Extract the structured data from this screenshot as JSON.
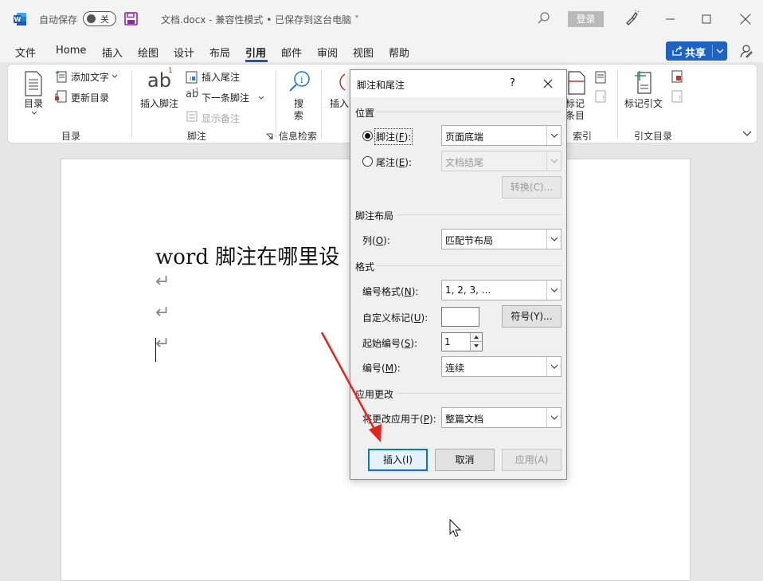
{
  "titlebar": {
    "autosave_label": "自动保存",
    "autosave_state": "关",
    "doc_title": "文档.docx  -  兼容性模式 • 已保存到这台电脑 ˅",
    "login_label": "登录",
    "window_controls": [
      "minimize-icon",
      "maximize-icon",
      "close-icon"
    ]
  },
  "menu": {
    "items": [
      "文件",
      "Home",
      "插入",
      "绘图",
      "设计",
      "布局",
      "引用",
      "邮件",
      "审阅",
      "视图",
      "帮助"
    ],
    "active": "引用",
    "share_label": "共享"
  },
  "ribbon": {
    "toc": {
      "button": "目录",
      "add_text": "添加文字",
      "update_toc": "更新目录",
      "group": "目录"
    },
    "footnotes": {
      "insert_footnote": "插入脚注",
      "insert_endnote": "插入尾注",
      "next_footnote": "下一条脚注",
      "show_notes": "显示备注",
      "group": "脚注"
    },
    "research": {
      "search_1": "搜",
      "search_2": "索",
      "group": "信息检索"
    },
    "citations": {
      "insert": "插入"
    },
    "index": {
      "mark_1": "标记",
      "mark_2": "条目",
      "group": "索引"
    },
    "authorities": {
      "mark_citation": "标记引文",
      "group": "引文目录"
    }
  },
  "document": {
    "heading": "word 脚注在哪里设",
    "para_mark": "↵"
  },
  "dialog": {
    "title": "脚注和尾注",
    "help": "?",
    "location": {
      "section": "位置",
      "footnote_label": "脚注",
      "footnote_key": "F",
      "footnote_value": "页面底端",
      "endnote_label": "尾注",
      "endnote_key": "E",
      "endnote_value": "文档结尾",
      "convert_label": "转换(C)..."
    },
    "layout": {
      "section": "脚注布局",
      "columns_label": "列",
      "columns_key": "O",
      "columns_value": "匹配节布局"
    },
    "format": {
      "section": "格式",
      "number_format_label": "编号格式",
      "number_format_key": "N",
      "number_format_value": "1, 2, 3, ...",
      "custom_mark_label": "自定义标记",
      "custom_mark_key": "U",
      "custom_mark_value": "",
      "symbol_label": "符号(Y)...",
      "start_at_label": "起始编号",
      "start_at_key": "S",
      "start_at_value": "1",
      "numbering_label": "编号",
      "numbering_key": "M",
      "numbering_value": "连续"
    },
    "apply": {
      "section": "应用更改",
      "apply_to_label": "将更改应用于",
      "apply_to_key": "P",
      "apply_to_value": "整篇文档"
    },
    "buttons": {
      "insert": "插入(I)",
      "cancel": "取消",
      "apply": "应用(A)"
    }
  },
  "colors": {
    "accent": "#2b579a",
    "share": "#1f63c2",
    "annotation_arrow": "#e8231c"
  }
}
